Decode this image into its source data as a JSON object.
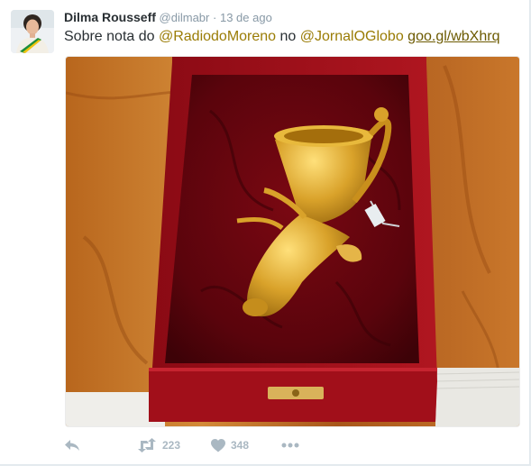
{
  "tweet": {
    "author_name": "Dilma Rousseff",
    "author_handle": "@dilmabr",
    "separator": "·",
    "time": "13 de ago",
    "text_prefix": "Sobre nota do ",
    "mention1": "@RadiodoMoreno",
    "text_mid": " no ",
    "mention2": "@JornalOGlobo",
    "text_space": " ",
    "link": "goo.gl/wbXhrq"
  },
  "actions": {
    "retweet_count": "223",
    "like_count": "348"
  },
  "colors": {
    "mention": "#9a7c05",
    "link": "#6c5a00",
    "meta": "#8899a6",
    "icons": "#aab8c2"
  },
  "icons": [
    "reply-icon",
    "retweet-icon",
    "heart-icon",
    "more-icon"
  ]
}
